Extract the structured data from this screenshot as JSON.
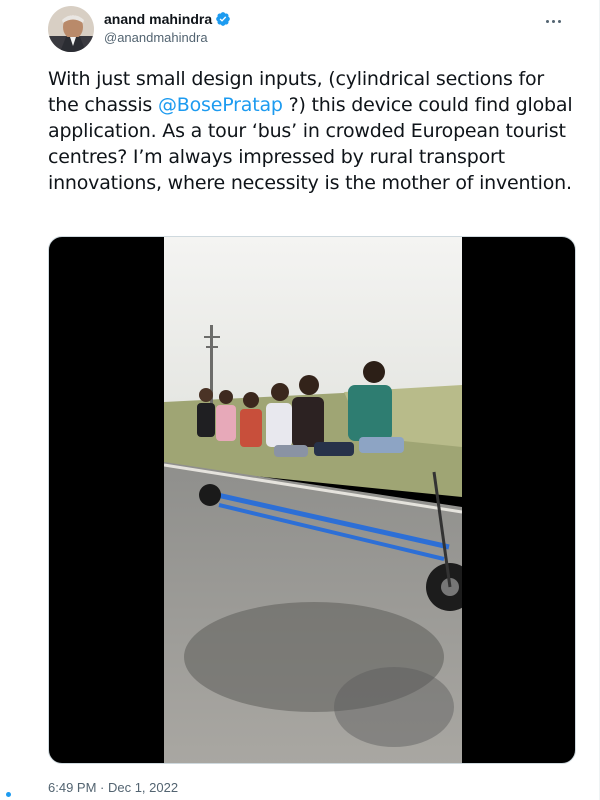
{
  "author": {
    "display_name": "anand mahindra",
    "handle": "@anandmahindra",
    "verified_icon": "verified-badge-icon",
    "avatar_icon": "profile-avatar"
  },
  "tweet": {
    "text_part1": "With just small design inputs, (cylindrical sections for the chassis ",
    "mention": "@BosePratap",
    "text_part2": " ?) this device could find global application. As a tour ‘bus’ in crowded European tourist centres? I’m always impressed by rural transport innovations, where necessity is the mother of invention.",
    "timestamp": "6:49 PM · Dec 1, 2022"
  },
  "media": {
    "type": "video",
    "description_icon": "video-thumbnail"
  },
  "colors": {
    "link": "#1d9bf0",
    "secondary_text": "#536471",
    "primary_text": "#0f1419",
    "verified": "#1d9bf0"
  },
  "more_icon": "more-horizontal-icon"
}
